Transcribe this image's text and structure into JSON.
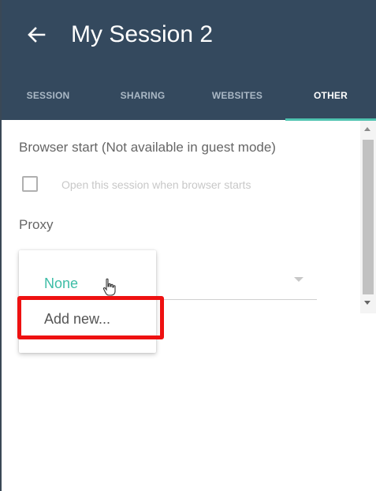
{
  "header": {
    "title": "My Session 2",
    "back_icon": "arrow-left-icon",
    "background": "#34495e"
  },
  "tabs": [
    {
      "label": "SESSION",
      "active": false
    },
    {
      "label": "SHARING",
      "active": false
    },
    {
      "label": "WEBSITES",
      "active": false
    },
    {
      "label": "OTHER",
      "active": true
    }
  ],
  "accent_color": "#4fc3b0",
  "browser_start": {
    "heading": "Browser start (Not available in guest mode)",
    "checkbox_label": "Open this session when browser starts",
    "checked": false
  },
  "proxy": {
    "heading": "Proxy",
    "selected_value": "None",
    "options": [
      "None",
      "Add new..."
    ]
  },
  "highlight_color": "#ee1111"
}
